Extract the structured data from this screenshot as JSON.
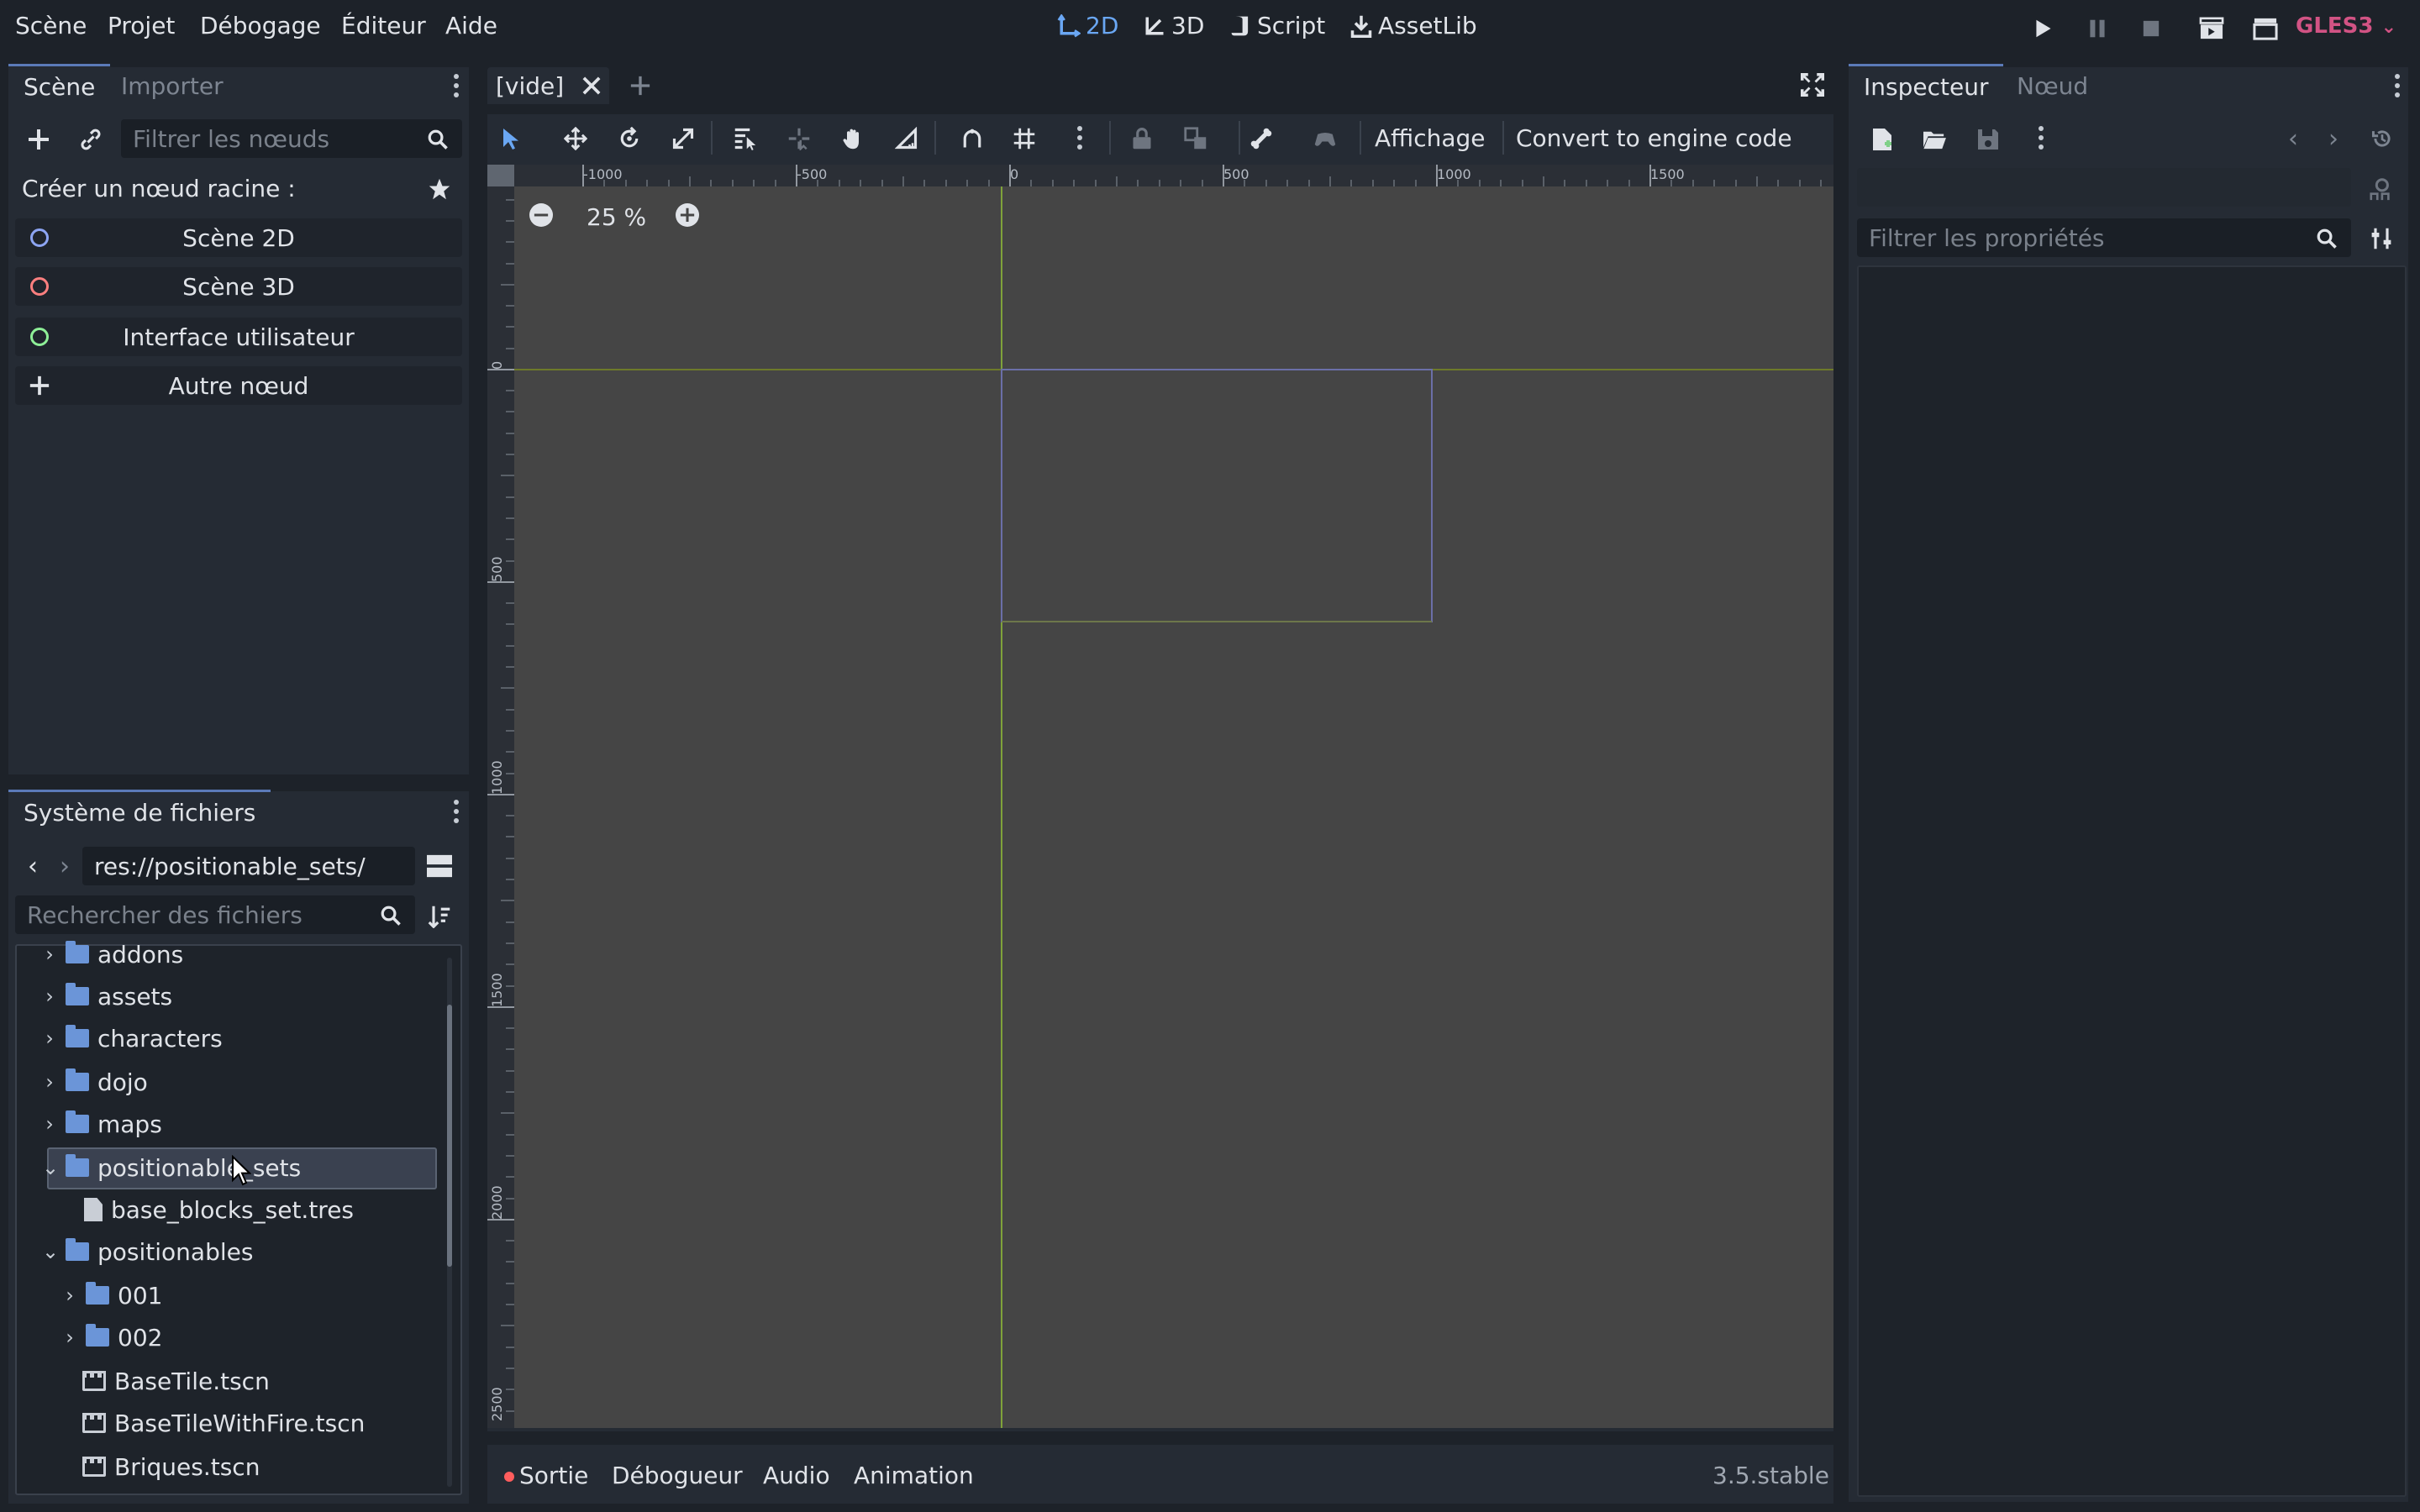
{
  "menu": [
    "Scène",
    "Projet",
    "Débogage",
    "Éditeur",
    "Aide"
  ],
  "workspaces": [
    {
      "label": "2D",
      "icon": "2d-axes-icon",
      "active": true
    },
    {
      "label": "3D",
      "icon": "3d-axes-icon",
      "active": false
    },
    {
      "label": "Script",
      "icon": "script-icon",
      "active": false
    },
    {
      "label": "AssetLib",
      "icon": "download-icon",
      "active": false
    }
  ],
  "renderer": "GLES3",
  "scene_dock": {
    "tabs": [
      "Scène",
      "Importer"
    ],
    "filter_placeholder": "Filtrer les nœuds",
    "create_root_label": "Créer un nœud racine :",
    "root_buttons": [
      {
        "label": "Scène 2D",
        "color": "#8da5f3"
      },
      {
        "label": "Scène 3D",
        "color": "#fc7f7f"
      },
      {
        "label": "Interface utilisateur",
        "color": "#8eef97"
      },
      {
        "label": "Autre nœud"
      }
    ]
  },
  "filesystem_dock": {
    "title": "Système de fichiers",
    "path": "res://positionable_sets/",
    "search_placeholder": "Rechercher des fichiers",
    "items": [
      {
        "label": "addons",
        "type": "folder",
        "expanded": false,
        "depth": 1
      },
      {
        "label": "assets",
        "type": "folder",
        "expanded": false,
        "depth": 1
      },
      {
        "label": "characters",
        "type": "folder",
        "expanded": false,
        "depth": 1
      },
      {
        "label": "dojo",
        "type": "folder",
        "expanded": false,
        "depth": 1
      },
      {
        "label": "maps",
        "type": "folder",
        "expanded": false,
        "depth": 1
      },
      {
        "label": "positionable_sets",
        "type": "folder",
        "expanded": true,
        "depth": 1,
        "selected": true
      },
      {
        "label": "base_blocks_set.tres",
        "type": "file",
        "depth": 2
      },
      {
        "label": "positionables",
        "type": "folder",
        "expanded": true,
        "depth": 1
      },
      {
        "label": "001",
        "type": "folder",
        "expanded": false,
        "depth": 2
      },
      {
        "label": "002",
        "type": "folder",
        "expanded": false,
        "depth": 2
      },
      {
        "label": "BaseTile.tscn",
        "type": "scene",
        "depth": 2
      },
      {
        "label": "BaseTileWithFire.tscn",
        "type": "scene",
        "depth": 2
      },
      {
        "label": "Briques.tscn",
        "type": "scene",
        "depth": 2
      }
    ]
  },
  "editor": {
    "scene_tab": "[vide]",
    "toolbar_view_label": "Affichage",
    "toolbar_convert_label": "Convert to engine code",
    "zoom": "25 %",
    "hruler_labels": [
      "-1000",
      "-500",
      "0",
      "500",
      "1000",
      "1500"
    ],
    "vruler_labels": [
      "0",
      "500",
      "1000",
      "1500",
      "2000",
      "2500"
    ]
  },
  "bottom_panel": {
    "tabs": [
      "Sortie",
      "Débogueur",
      "Audio",
      "Animation"
    ],
    "version": "3.5.stable"
  },
  "inspector": {
    "tabs": [
      "Inspecteur",
      "Nœud"
    ],
    "filter_placeholder": "Filtrer les propriétés"
  }
}
